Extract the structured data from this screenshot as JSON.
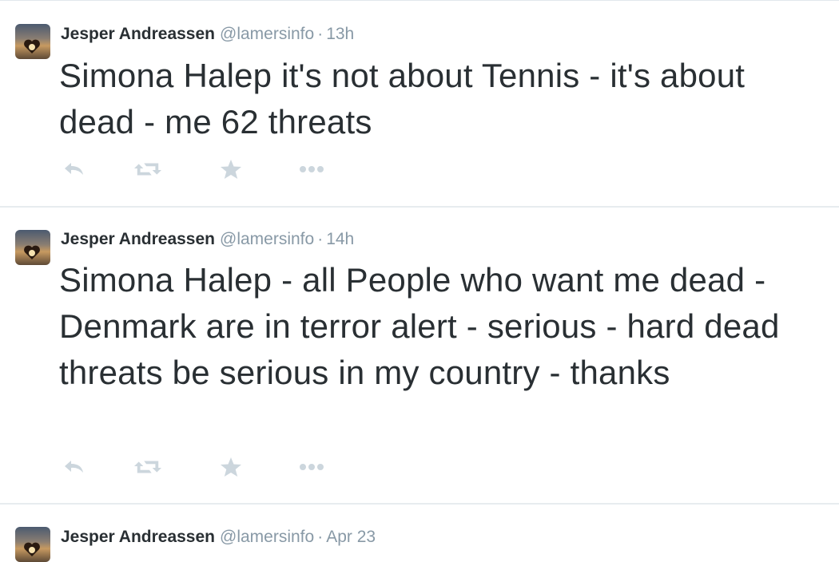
{
  "colors": {
    "text": "#292f33",
    "secondary": "#8899a6",
    "action_icon": "#ccd6dd",
    "divider": "#e7ecef"
  },
  "tweets": [
    {
      "name": "Jesper Andreassen",
      "handle": "@lamersinfo",
      "separator": "·",
      "time": "13h",
      "text": "Simona Halep it's not about Tennis - it's about dead - me 62 threats",
      "actions": [
        "reply-icon",
        "retweet-icon",
        "favorite-star-icon",
        "more-dots-icon"
      ]
    },
    {
      "name": "Jesper Andreassen",
      "handle": "@lamersinfo",
      "separator": "·",
      "time": "14h",
      "text": "Simona Halep - all People who want me dead - Denmark are in terror alert - serious - hard dead threats be serious in my country - thanks",
      "actions": [
        "reply-icon",
        "retweet-icon",
        "favorite-star-icon",
        "more-dots-icon"
      ]
    },
    {
      "name": "Jesper Andreassen",
      "handle": "@lamersinfo",
      "separator": "·",
      "time": "Apr 23",
      "text": "",
      "actions": []
    }
  ]
}
